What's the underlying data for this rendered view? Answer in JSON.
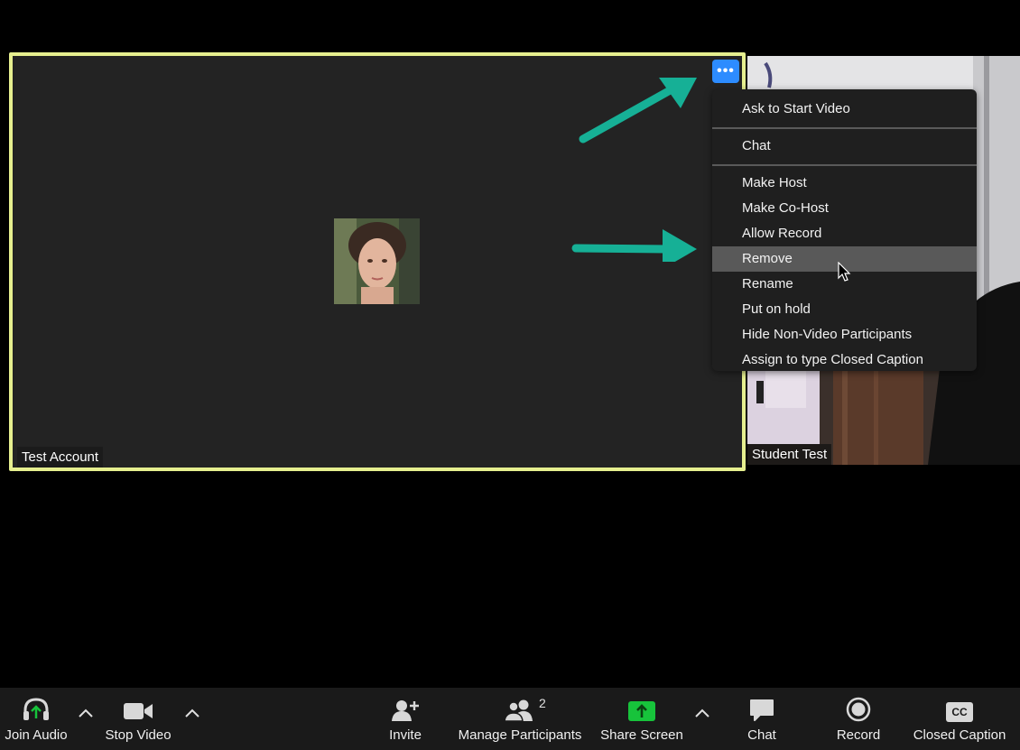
{
  "tiles": {
    "main_name": "Test Account",
    "side_name": "Student Test"
  },
  "more_button": {
    "label": "•••"
  },
  "context_menu": {
    "group1": [
      "Ask to Start Video"
    ],
    "group2": [
      "Chat"
    ],
    "group3": [
      "Make Host",
      "Make Co-Host",
      "Allow Record",
      "Remove",
      "Rename",
      "Put on hold",
      "Hide Non-Video Participants",
      "Assign to type Closed Caption"
    ],
    "hovered": "Remove"
  },
  "toolbar": {
    "join_audio": "Join Audio",
    "stop_video": "Stop Video",
    "invite": "Invite",
    "manage_participants": "Manage Participants",
    "participant_count": "2",
    "share_screen": "Share Screen",
    "chat": "Chat",
    "record": "Record",
    "closed_caption": "Closed Caption",
    "cc_badge": "CC"
  },
  "colors": {
    "active_speaker_border": "#e6ef8f",
    "accent_blue": "#2d8cff",
    "annotation_arrow": "#16b096",
    "share_green": "#17c33b"
  }
}
